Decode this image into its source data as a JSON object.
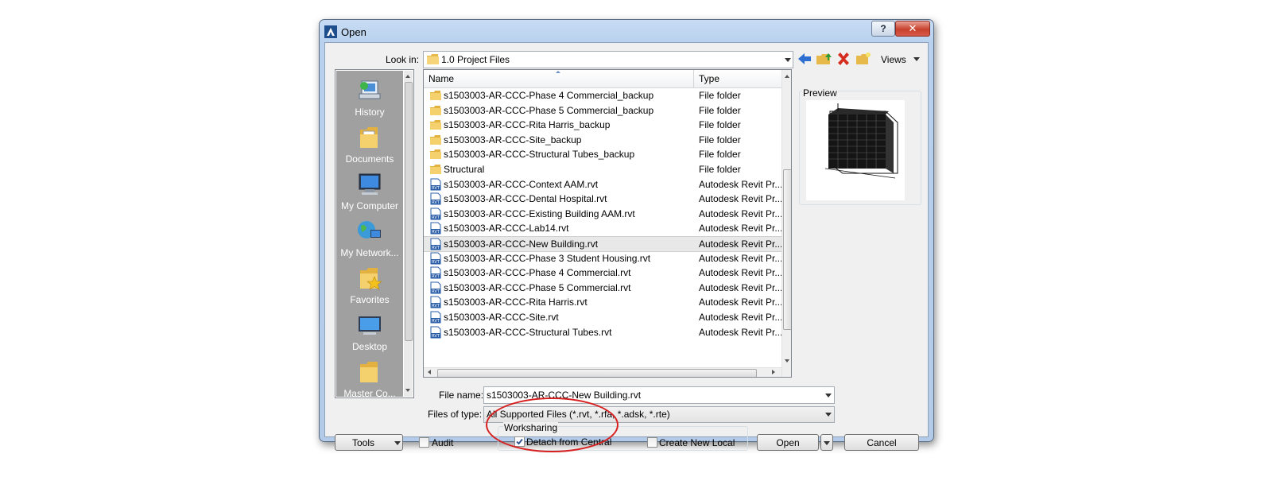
{
  "window": {
    "title": "Open",
    "help_glyph": "?",
    "close_glyph": "✕"
  },
  "look_in": {
    "label": "Look in:",
    "value": "1.0 Project Files"
  },
  "toolbar": {
    "views_label": "Views"
  },
  "places": [
    {
      "label": "History",
      "icon": "history-icon"
    },
    {
      "label": "Documents",
      "icon": "documents-icon"
    },
    {
      "label": "My Computer",
      "icon": "my-computer-icon"
    },
    {
      "label": "My Network...",
      "icon": "my-network-icon"
    },
    {
      "label": "Favorites",
      "icon": "favorites-icon"
    },
    {
      "label": "Desktop",
      "icon": "desktop-icon"
    },
    {
      "label": "Master Co...",
      "icon": "folder-icon"
    }
  ],
  "list": {
    "columns": {
      "name": "Name",
      "type": "Type"
    },
    "rows": [
      {
        "name": "s1503003-AR-CCC-Phase 4 Commercial_backup",
        "type": "File folder",
        "kind": "folder"
      },
      {
        "name": "s1503003-AR-CCC-Phase 5 Commercial_backup",
        "type": "File folder",
        "kind": "folder"
      },
      {
        "name": "s1503003-AR-CCC-Rita Harris_backup",
        "type": "File folder",
        "kind": "folder"
      },
      {
        "name": "s1503003-AR-CCC-Site_backup",
        "type": "File folder",
        "kind": "folder"
      },
      {
        "name": "s1503003-AR-CCC-Structural Tubes_backup",
        "type": "File folder",
        "kind": "folder"
      },
      {
        "name": "Structural",
        "type": "File folder",
        "kind": "folder"
      },
      {
        "name": "s1503003-AR-CCC-Context AAM.rvt",
        "type": "Autodesk Revit Pr...",
        "kind": "rvt"
      },
      {
        "name": "s1503003-AR-CCC-Dental Hospital.rvt",
        "type": "Autodesk Revit Pr...",
        "kind": "rvt"
      },
      {
        "name": "s1503003-AR-CCC-Existing Building AAM.rvt",
        "type": "Autodesk Revit Pr...",
        "kind": "rvt"
      },
      {
        "name": "s1503003-AR-CCC-Lab14.rvt",
        "type": "Autodesk Revit Pr...",
        "kind": "rvt"
      },
      {
        "name": "s1503003-AR-CCC-New Building.rvt",
        "type": "Autodesk Revit Pr...",
        "kind": "rvt",
        "selected": true
      },
      {
        "name": "s1503003-AR-CCC-Phase 3 Student Housing.rvt",
        "type": "Autodesk Revit Pr...",
        "kind": "rvt"
      },
      {
        "name": "s1503003-AR-CCC-Phase 4 Commercial.rvt",
        "type": "Autodesk Revit Pr...",
        "kind": "rvt"
      },
      {
        "name": "s1503003-AR-CCC-Phase 5 Commercial.rvt",
        "type": "Autodesk Revit Pr...",
        "kind": "rvt"
      },
      {
        "name": "s1503003-AR-CCC-Rita Harris.rvt",
        "type": "Autodesk Revit Pr...",
        "kind": "rvt"
      },
      {
        "name": "s1503003-AR-CCC-Site.rvt",
        "type": "Autodesk Revit Pr...",
        "kind": "rvt"
      },
      {
        "name": "s1503003-AR-CCC-Structural Tubes.rvt",
        "type": "Autodesk Revit Pr...",
        "kind": "rvt"
      }
    ]
  },
  "preview": {
    "label": "Preview"
  },
  "file_name": {
    "label": "File name:",
    "value": "s1503003-AR-CCC-New Building.rvt"
  },
  "file_type": {
    "label": "Files of type:",
    "value": "All Supported Files  (*.rvt, *.rfa, *.adsk, *.rte)"
  },
  "bottom": {
    "tools_label": "Tools",
    "audit_label": "Audit",
    "audit_checked": false,
    "worksharing_label": "Worksharing",
    "detach_label": "Detach from Central",
    "detach_checked": true,
    "create_local_label": "Create New Local",
    "create_local_checked": false,
    "open_label": "Open",
    "cancel_label": "Cancel"
  },
  "colors": {
    "annotation_circle": "#d81f1f",
    "places_bg": "#a0a0a0",
    "title_gradient": "#c7dcf3"
  }
}
